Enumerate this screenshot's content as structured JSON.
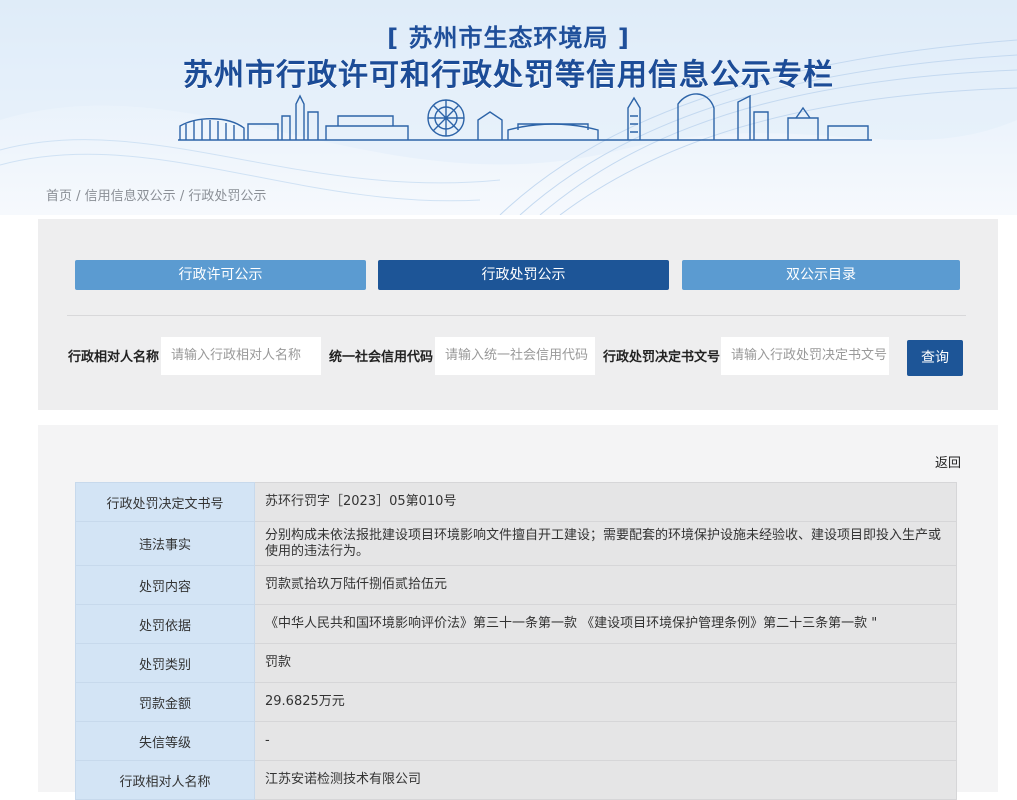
{
  "header": {
    "subtitle": "[ 苏州市生态环境局 ]",
    "title": "苏州市行政许可和行政处罚等信用信息公示专栏"
  },
  "breadcrumb": {
    "items": [
      "首页",
      "信用信息双公示",
      "行政处罚公示"
    ],
    "separator": " / "
  },
  "tabs": [
    {
      "label": "行政许可公示",
      "active": false
    },
    {
      "label": "行政处罚公示",
      "active": true
    },
    {
      "label": "双公示目录",
      "active": false
    }
  ],
  "search": {
    "fields": [
      {
        "label": "行政相对人名称",
        "placeholder": "请输入行政相对人名称"
      },
      {
        "label": "统一社会信用代码",
        "placeholder": "请输入统一社会信用代码"
      },
      {
        "label": "行政处罚决定书文号",
        "placeholder": "请输入行政处罚决定书文号"
      }
    ],
    "button_label": "查询"
  },
  "detail": {
    "back_label": "返回",
    "rows": [
      {
        "key": "行政处罚决定文书号",
        "value": "苏环行罚字［2023］05第010号"
      },
      {
        "key": "违法事实",
        "value": "分别构成未依法报批建设项目环境影响文件擅自开工建设；需要配套的环境保护设施未经验收、建设项目即投入生产或使用的违法行为。"
      },
      {
        "key": "处罚内容",
        "value": "罚款贰拾玖万陆仟捌佰贰拾伍元"
      },
      {
        "key": "处罚依据",
        "value": "《中华人民共和国环境影响评价法》第三十一条第一款 《建设项目环境保护管理条例》第二十三条第一款 \""
      },
      {
        "key": "处罚类别",
        "value": "罚款"
      },
      {
        "key": "罚款金额",
        "value": "29.6825万元"
      },
      {
        "key": "失信等级",
        "value": "-"
      },
      {
        "key": "行政相对人名称",
        "value": "江苏安诺检测技术有限公司"
      }
    ]
  },
  "colors": {
    "primary": "#1d5597",
    "tab_inactive": "#5b9bd1",
    "key_cell": "#d3e4f5",
    "value_cell": "#e5e5e6",
    "title": "#1c4c97"
  }
}
